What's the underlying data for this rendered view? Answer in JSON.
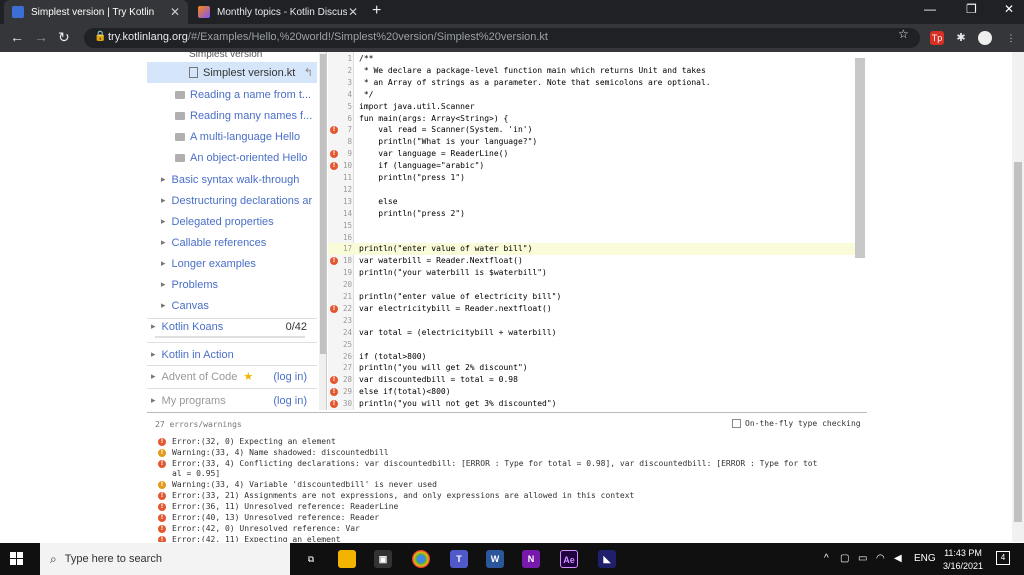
{
  "browser": {
    "tabs": [
      {
        "title": "Simplest version | Try Kotlin",
        "active": true
      },
      {
        "title": "Monthly topics - Kotlin Discussio",
        "active": false
      }
    ],
    "url_host": "try.kotlinlang.org",
    "url_path": "/#/Examples/Hello,%20world!/Simplest%20version/Simplest%20version.kt",
    "ext_tp": "Tp"
  },
  "sidebar": {
    "top_cut": "Simplest version",
    "items": [
      {
        "label": "Simplest version.kt",
        "kind": "file",
        "selected": true
      },
      {
        "label": "Reading a name from t...",
        "kind": "folder"
      },
      {
        "label": "Reading many names f...",
        "kind": "folder"
      },
      {
        "label": "A multi-language Hello",
        "kind": "folder"
      },
      {
        "label": "An object-oriented Hello",
        "kind": "folder"
      },
      {
        "label": "Basic syntax walk-through",
        "kind": "section"
      },
      {
        "label": "Destructuring declarations ar",
        "kind": "section"
      },
      {
        "label": "Delegated properties",
        "kind": "section"
      },
      {
        "label": "Callable references",
        "kind": "section"
      },
      {
        "label": "Longer examples",
        "kind": "section"
      },
      {
        "label": "Problems",
        "kind": "section"
      },
      {
        "label": "Canvas",
        "kind": "section"
      }
    ],
    "koans": {
      "label": "Kotlin Koans",
      "progress": "0/42"
    },
    "kia": {
      "label": "Kotlin in Action"
    },
    "advent": {
      "label": "Advent of Code",
      "login": "(log in)"
    },
    "myprograms": {
      "label": "My programs",
      "login": "(log in)"
    }
  },
  "editor": {
    "lines": [
      {
        "n": "1",
        "code": "/**",
        "err": false
      },
      {
        "n": "2",
        "code": " * We declare a package-level function main which returns Unit and takes",
        "err": false
      },
      {
        "n": "3",
        "code": " * an Array of strings as a parameter. Note that semicolons are optional.",
        "err": false
      },
      {
        "n": "4",
        "code": " */",
        "err": false
      },
      {
        "n": "5",
        "code": "import java.util.Scanner",
        "err": false
      },
      {
        "n": "6",
        "code": "fun main(args: Array<String>) {",
        "err": false
      },
      {
        "n": "7",
        "code": "    val read = Scanner(System. 'in')",
        "err": true
      },
      {
        "n": "8",
        "code": "    println(\"What is your language?\")",
        "err": false
      },
      {
        "n": "9",
        "code": "    var language = ReaderLine()",
        "err": true
      },
      {
        "n": "10",
        "code": "    if (language=\"arabic\")",
        "err": true
      },
      {
        "n": "11",
        "code": "    println(\"press 1\")",
        "err": false
      },
      {
        "n": "12",
        "code": "",
        "err": false
      },
      {
        "n": "13",
        "code": "    else",
        "err": false
      },
      {
        "n": "14",
        "code": "    println(\"press 2\")",
        "err": false
      },
      {
        "n": "15",
        "code": "",
        "err": false
      },
      {
        "n": "16",
        "code": "",
        "err": false
      },
      {
        "n": "17",
        "code": "println(\"enter value of water bill\")",
        "err": false,
        "hl": true
      },
      {
        "n": "18",
        "code": "var waterbill = Reader.Nextfloat()",
        "err": true
      },
      {
        "n": "19",
        "code": "println(\"your waterbill is $waterbill\")",
        "err": false
      },
      {
        "n": "20",
        "code": "",
        "err": false
      },
      {
        "n": "21",
        "code": "println(\"enter value of electricity bill\")",
        "err": false
      },
      {
        "n": "22",
        "code": "var electricitybill = Reader.nextfloat()",
        "err": true
      },
      {
        "n": "23",
        "code": "",
        "err": false
      },
      {
        "n": "24",
        "code": "var total = (electricitybill + waterbill)",
        "err": false
      },
      {
        "n": "25",
        "code": "",
        "err": false
      },
      {
        "n": "26",
        "code": "if (total>800)",
        "err": false
      },
      {
        "n": "27",
        "code": "println(\"you will get 2% discount\")",
        "err": false
      },
      {
        "n": "28",
        "code": "var discountedbill = total = 0.98",
        "err": true
      },
      {
        "n": "29",
        "code": "else if(total)<800)",
        "err": true
      },
      {
        "n": "30",
        "code": "println(\"you will not get 3% discounted\")",
        "err": true
      }
    ]
  },
  "console": {
    "header": "27 errors/warnings",
    "otf": "On-the-fly type checking",
    "messages": [
      {
        "text": "Error:(32, 0) Expecting an element",
        "kind": "error"
      },
      {
        "text": "Warning:(33, 4) Name shadowed: discountedbill",
        "kind": "warn"
      },
      {
        "text": "Error:(33, 4) Conflicting declarations: var discountedbill: [ERROR : Type for total = 0.98], var discountedbill: [ERROR : Type for tot\nal = 0.95]",
        "kind": "error"
      },
      {
        "text": "Warning:(33, 4) Variable 'discountedbill' is never used",
        "kind": "warn"
      },
      {
        "text": "Error:(33, 21) Assignments are not expressions, and only expressions are allowed in this context",
        "kind": "error"
      },
      {
        "text": "Error:(36, 11) Unresolved reference: ReaderLine",
        "kind": "error"
      },
      {
        "text": "Error:(40, 13) Unresolved reference: Reader",
        "kind": "error"
      },
      {
        "text": "Error:(42, 0) Unresolved reference: Var",
        "kind": "error"
      },
      {
        "text": "Error:(42, 11) Expecting an element",
        "kind": "error"
      }
    ]
  },
  "taskbar": {
    "search_placeholder": "Type here to search",
    "lang": "ENG",
    "time": "11:43 PM",
    "date": "3/16/2021",
    "notif_count": "4"
  }
}
